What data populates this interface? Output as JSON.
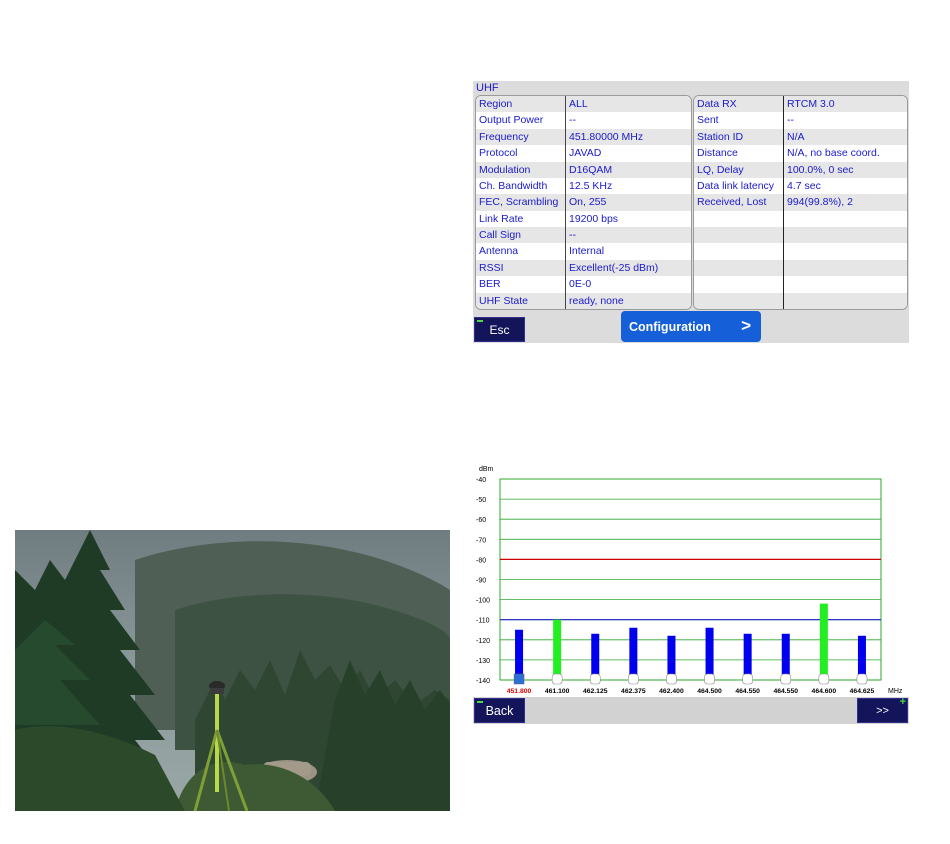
{
  "uhf": {
    "title": "UHF",
    "left_rows": [
      {
        "label": "Region",
        "value": "ALL"
      },
      {
        "label": "Output Power",
        "value": "--"
      },
      {
        "label": "Frequency",
        "value": "451.80000 MHz"
      },
      {
        "label": "Protocol",
        "value": "JAVAD"
      },
      {
        "label": "Modulation",
        "value": "D16QAM"
      },
      {
        "label": "Ch. Bandwidth",
        "value": "12.5 KHz"
      },
      {
        "label": "FEC, Scrambling",
        "value": "On, 255"
      },
      {
        "label": "Link Rate",
        "value": "19200 bps"
      },
      {
        "label": "Call Sign",
        "value": "--"
      },
      {
        "label": "Antenna",
        "value": "Internal"
      },
      {
        "label": "RSSI",
        "value": "Excellent(-25 dBm)"
      },
      {
        "label": "BER",
        "value": "0E-0"
      },
      {
        "label": "UHF State",
        "value": "ready, none"
      }
    ],
    "right_rows": [
      {
        "label": "Data RX",
        "value": "RTCM 3.0"
      },
      {
        "label": "Sent",
        "value": "--"
      },
      {
        "label": "Station ID",
        "value": "N/A"
      },
      {
        "label": "Distance",
        "value": "N/A, no base coord."
      },
      {
        "label": "LQ, Delay",
        "value": "100.0%, 0 sec"
      },
      {
        "label": "Data link latency",
        "value": "4.7 sec"
      },
      {
        "label": "Received, Lost",
        "value": "994(99.8%), 2"
      },
      {
        "label": "",
        "value": ""
      },
      {
        "label": "",
        "value": ""
      },
      {
        "label": "",
        "value": ""
      },
      {
        "label": "",
        "value": ""
      },
      {
        "label": "",
        "value": ""
      },
      {
        "label": "",
        "value": ""
      }
    ],
    "esc_label": "Esc",
    "config_label": "Configuration",
    "config_arrow": ">"
  },
  "spectrum": {
    "back_label": "Back",
    "next_label": ">>",
    "next_plus": "+"
  },
  "colors": {
    "label_blue": "#1a1acc",
    "button_navy": "#14145a",
    "config_blue": "#1560d8",
    "bar_blue": "#0000ee",
    "bar_green": "#22ee22",
    "grid_green": "#2ea82e",
    "threshold_red": "#cc0000",
    "threshold_blue": "#2222cc",
    "selected_channel_red": "#e00000"
  },
  "chart_data": {
    "type": "bar",
    "ylabel": "dBm",
    "xlabel": "MHz",
    "ylim": [
      -140,
      -40
    ],
    "yticks": [
      -40,
      -50,
      -60,
      -70,
      -80,
      -90,
      -100,
      -110,
      -120,
      -130,
      -140
    ],
    "grid": true,
    "categories": [
      "451.800",
      "461.100",
      "462.125",
      "462.375",
      "462.400",
      "464.500",
      "464.550",
      "464.550",
      "464.600",
      "464.625"
    ],
    "values": [
      -115,
      -110,
      -117,
      -114,
      -118,
      -114,
      -117,
      -117,
      -102,
      -118
    ],
    "bar_colors": [
      "blue",
      "green",
      "blue",
      "blue",
      "blue",
      "blue",
      "blue",
      "blue",
      "green",
      "blue"
    ],
    "selected_index": 0,
    "reference_lines": [
      {
        "value": -80,
        "color": "red"
      },
      {
        "value": -110,
        "color": "blue"
      }
    ]
  }
}
